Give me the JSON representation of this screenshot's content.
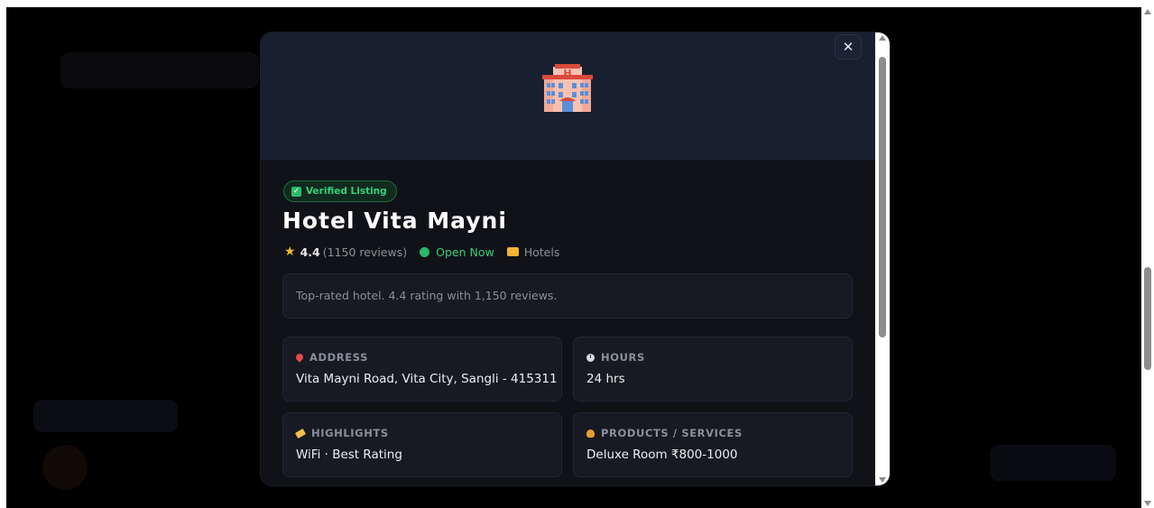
{
  "modal": {
    "close_symbol": "✕",
    "hero_icon": "hotel-icon",
    "badge": {
      "icon": "check-icon",
      "label": "Verified Listing"
    },
    "title": "Hotel Vita Mayni",
    "meta": {
      "star_symbol": "★",
      "rating": "4.4",
      "reviews": "(1150 reviews)",
      "status": "Open Now",
      "category": "Hotels"
    },
    "description": "Top-rated hotel. 4.4 rating with 1,150 reviews.",
    "cards": [
      {
        "icon": "pin-icon",
        "label": "ADDRESS",
        "value": "Vita Mayni Road, Vita City, Sangli - 415311"
      },
      {
        "icon": "clock-icon",
        "label": "HOURS",
        "value": "24 hrs"
      },
      {
        "icon": "tag-icon",
        "label": "HIGHLIGHTS",
        "value": "WiFi · Best Rating"
      },
      {
        "icon": "money-bag-icon",
        "label": "PRODUCTS / SERVICES",
        "value": "Deluxe Room ₹800-1000"
      }
    ]
  },
  "colors": {
    "backdrop": "#000000",
    "modal_bg": "#111217",
    "hero_bg": "#18202f",
    "accent_green": "#34d07a",
    "text_muted": "#8a8f9c"
  }
}
